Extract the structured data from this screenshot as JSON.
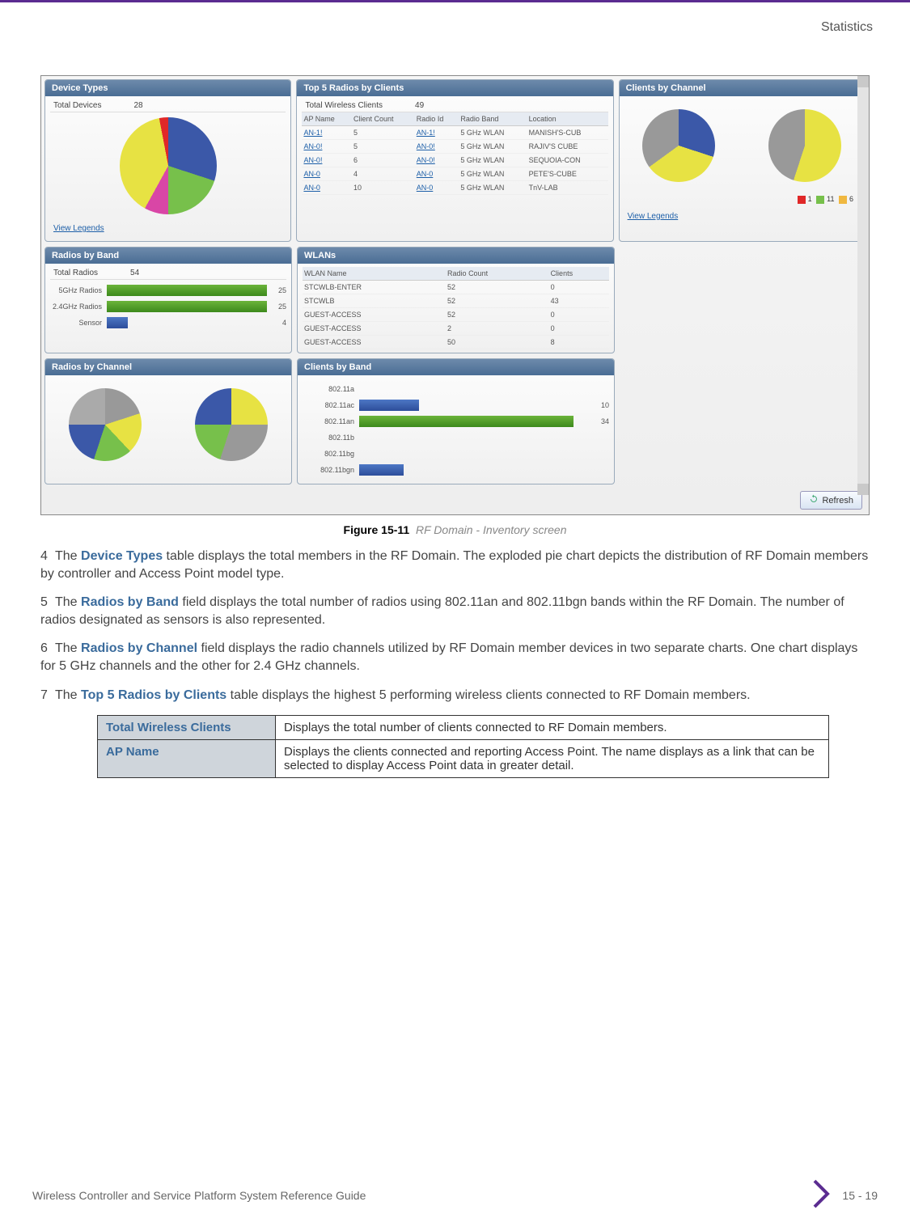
{
  "header": {
    "section_label": "Statistics"
  },
  "figure": {
    "caption_strong": "Figure 15-11",
    "caption_em": "RF Domain - Inventory screen"
  },
  "panels": {
    "device_types": {
      "title": "Device Types",
      "total_label": "Total Devices",
      "total_value": "28",
      "view_legends": "View Legends"
    },
    "top5radios": {
      "title": "Top 5 Radios by Clients",
      "total_label": "Total Wireless Clients",
      "total_value": "49",
      "headers": [
        "AP Name",
        "Client Count",
        "Radio Id",
        "Radio Band",
        "Location"
      ],
      "rows": [
        {
          "ap": "AN-1!",
          "count": "5",
          "rid": "AN-1!",
          "band": "5 GHz WLAN",
          "loc": "MANISH'S-CUB"
        },
        {
          "ap": "AN-0!",
          "count": "5",
          "rid": "AN-0!",
          "band": "5 GHz WLAN",
          "loc": "RAJIV'S CUBE"
        },
        {
          "ap": "AN-0!",
          "count": "6",
          "rid": "AN-0!",
          "band": "5 GHz WLAN",
          "loc": "SEQUOIA-CON"
        },
        {
          "ap": "AN-0",
          "count": "4",
          "rid": "AN-0",
          "band": "5 GHz WLAN",
          "loc": "PETE'S-CUBE"
        },
        {
          "ap": "AN-0",
          "count": "10",
          "rid": "AN-0",
          "band": "5 GHz WLAN",
          "loc": "TnV-LAB"
        }
      ]
    },
    "clients_by_channel": {
      "title": "Clients by Channel",
      "view_legends": "View Legends",
      "legend": [
        {
          "c": "#e02828",
          "v": "1"
        },
        {
          "c": "#77c04b",
          "v": "11"
        },
        {
          "c": "#f0b840",
          "v": "6"
        }
      ]
    },
    "radios_by_band": {
      "title": "Radios by Band",
      "total_label": "Total Radios",
      "total_value": "54",
      "bars": [
        {
          "label": "5GHz Radios",
          "val": "25",
          "pct": 95,
          "cls": ""
        },
        {
          "label": "2.4GHz Radios",
          "val": "25",
          "pct": 95,
          "cls": ""
        },
        {
          "label": "Sensor",
          "val": "4",
          "pct": 12,
          "cls": "blue"
        }
      ]
    },
    "wlans": {
      "title": "WLANs",
      "headers": [
        "WLAN Name",
        "Radio Count",
        "Clients"
      ],
      "rows": [
        {
          "n": "STCWLB-ENTER",
          "r": "52",
          "c": "0"
        },
        {
          "n": "STCWLB",
          "r": "52",
          "c": "43"
        },
        {
          "n": "GUEST-ACCESS",
          "r": "52",
          "c": "0"
        },
        {
          "n": "GUEST-ACCESS",
          "r": "2",
          "c": "0"
        },
        {
          "n": "GUEST-ACCESS",
          "r": "50",
          "c": "8"
        }
      ]
    },
    "radios_by_channel": {
      "title": "Radios by Channel"
    },
    "clients_by_band": {
      "title": "Clients by Band",
      "bars": [
        {
          "label": "802.11a",
          "val": "",
          "pct": 0,
          "cls": "blue"
        },
        {
          "label": "802.11ac",
          "val": "10",
          "pct": 25,
          "cls": "blue"
        },
        {
          "label": "802.11an",
          "val": "34",
          "pct": 90,
          "cls": ""
        },
        {
          "label": "802.11b",
          "val": "",
          "pct": 0,
          "cls": ""
        },
        {
          "label": "802.11bg",
          "val": "",
          "pct": 0,
          "cls": ""
        },
        {
          "label": "802.11bgn",
          "val": "",
          "pct": 18,
          "cls": "blue"
        }
      ]
    }
  },
  "refresh_label": "Refresh",
  "chart_data": [
    {
      "type": "pie",
      "title": "Device Types",
      "total": 28,
      "note": "exploded pie of device model distribution (values unlabeled)"
    },
    {
      "type": "table",
      "title": "Top 5 Radios by Clients",
      "total_wireless_clients": 49,
      "columns": [
        "AP Name",
        "Client Count",
        "Radio Id",
        "Radio Band",
        "Location"
      ],
      "rows": [
        [
          "AN-1!",
          5,
          "AN-1!",
          "5 GHz WLAN",
          "MANISH'S-CUB"
        ],
        [
          "AN-0!",
          5,
          "AN-0!",
          "5 GHz WLAN",
          "RAJIV'S CUBE"
        ],
        [
          "AN-0!",
          6,
          "AN-0!",
          "5 GHz WLAN",
          "SEQUOIA-CON"
        ],
        [
          "AN-0",
          4,
          "AN-0",
          "5 GHz WLAN",
          "PETE'S-CUBE"
        ],
        [
          "AN-0",
          10,
          "AN-0",
          "5 GHz WLAN",
          "TnV-LAB"
        ]
      ]
    },
    {
      "type": "pie",
      "title": "Clients by Channel",
      "legend": [
        {
          "label": "1"
        },
        {
          "label": "11"
        },
        {
          "label": "6"
        }
      ]
    },
    {
      "type": "bar",
      "title": "Radios by Band",
      "orientation": "horizontal",
      "categories": [
        "5GHz Radios",
        "2.4GHz Radios",
        "Sensor"
      ],
      "values": [
        25,
        25,
        4
      ],
      "total": 54
    },
    {
      "type": "table",
      "title": "WLANs",
      "columns": [
        "WLAN Name",
        "Radio Count",
        "Clients"
      ],
      "rows": [
        [
          "STCWLB-ENTER",
          52,
          0
        ],
        [
          "STCWLB",
          52,
          43
        ],
        [
          "GUEST-ACCESS",
          52,
          0
        ],
        [
          "GUEST-ACCESS",
          2,
          0
        ],
        [
          "GUEST-ACCESS",
          50,
          8
        ]
      ]
    },
    {
      "type": "pie",
      "title": "Radios by Channel",
      "note": "two pies: 5 GHz and 2.4 GHz channel distribution (values unlabeled)"
    },
    {
      "type": "bar",
      "title": "Clients by Band",
      "orientation": "horizontal",
      "categories": [
        "802.11a",
        "802.11ac",
        "802.11an",
        "802.11b",
        "802.11bg",
        "802.11bgn"
      ],
      "values": [
        0,
        10,
        34,
        0,
        0,
        null
      ]
    }
  ],
  "paragraphs": {
    "p4_num": "4",
    "p4_a": "The ",
    "p4_strong": "Device Types",
    "p4_b": " table displays the total members in the RF Domain. The exploded pie chart depicts the distribution of RF Domain members by controller and Access Point model type.",
    "p5_num": "5",
    "p5_a": "The ",
    "p5_strong": "Radios by Band",
    "p5_b": " field displays the total number of radios using 802.11an and 802.11bgn bands within the RF Domain. The number of radios designated as sensors is also represented.",
    "p6_num": "6",
    "p6_a": "The ",
    "p6_strong": "Radios by Channel",
    "p6_b": " field displays the radio channels utilized by RF Domain member devices in two separate charts. One chart displays for 5 GHz channels and the other for 2.4 GHz channels.",
    "p7_num": "7",
    "p7_a": "The ",
    "p7_strong": "Top 5 Radios by Clients",
    "p7_b": " table displays the highest 5 performing wireless clients connected to RF Domain members."
  },
  "desc_table": {
    "r1_label": "Total Wireless Clients",
    "r1_desc": "Displays the total number of clients connected to RF Domain members.",
    "r2_label": "AP Name",
    "r2_desc": "Displays the clients connected and reporting Access Point. The name displays as a link that can be selected to display Access Point data in greater detail."
  },
  "footer": {
    "doc_title": "Wireless Controller and Service Platform System Reference Guide",
    "page": "15 - 19"
  }
}
